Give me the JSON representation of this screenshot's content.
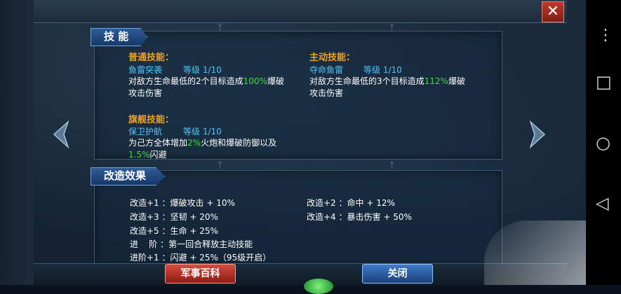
{
  "skills": {
    "tab_label": "技 能",
    "normal": {
      "header": "普通技能：",
      "name": "鱼雷突袭",
      "level": "等级 1/10",
      "desc_pre": "对敌方生命最低的2个目标造成",
      "desc_value": "100%",
      "desc_post": "爆破攻击伤害"
    },
    "active": {
      "header": "主动技能：",
      "name": "夺命鱼雷",
      "level": "等级 1/10",
      "desc_pre": "对敌方生命最低的3个目标造成",
      "desc_value": "112%",
      "desc_post": "爆破攻击伤害"
    },
    "flagship": {
      "header": "旗舰技能：",
      "name": "保卫护航",
      "level": "等级 1/10",
      "desc_pre": "为己方全体增加",
      "desc_value1": "2%",
      "desc_mid": "火炮和爆破防御以及",
      "desc_value2": "1.5%",
      "desc_post": "闪避"
    }
  },
  "modification": {
    "tab_label": "改造效果",
    "lines_left": [
      "改造+1 ：爆破攻击 + 10%",
      "改造+3 ：坚韧 + 20%",
      "改造+5 ：生命 + 25%",
      "进    阶 ：第一回合释放主动技能",
      "进阶+1 ：闪避 + 25%（95级开启）"
    ],
    "lines_right": [
      "改造+2 ：命中 + 12%",
      "改造+4 ：暴击伤害 + 50%"
    ]
  },
  "buttons": {
    "encyclopedia": "军事百科",
    "close": "关闭",
    "close_x": "✕"
  },
  "decor": {
    "sep": "ᛉ"
  },
  "android_nav": {
    "menu": "⋮",
    "recent": "□",
    "home": "○",
    "back": "◁"
  },
  "colors": {
    "highlight_green": "#3ddc3d",
    "skill_name_blue": "#4dc3ff",
    "header_orange": "#f0a020"
  }
}
